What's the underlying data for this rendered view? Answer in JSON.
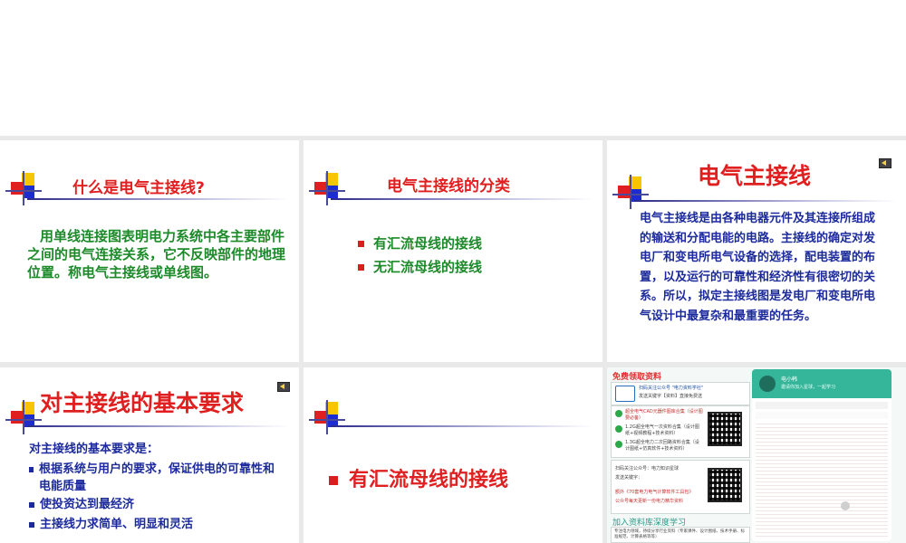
{
  "slides": {
    "s1": {
      "title": "什么是电气主接线?",
      "body": "用单线连接图表明电力系统中各主要部件之间的电气连接关系，它不反映部件的地理位置。称电气主接线或单线图。"
    },
    "s2": {
      "title": "电气主接线的分类",
      "items": [
        "有汇流母线的接线",
        "无汇流母线的接线"
      ]
    },
    "s3": {
      "title": "电气主接线",
      "body": "电气主接线是由各种电器元件及其连接所组成的输送和分配电能的电路。主接线的确定对发电厂和变电所电气设备的选择，配电装置的布置，以及运行的可靠性和经济性有很密切的关系。所以，拟定主接线图是发电厂和变电所电气设计中最复杂和最重要的任务。"
    },
    "s4": {
      "title": "对主接线的基本要求",
      "intro": "对主接线的基本要求是：",
      "items": [
        "根据系统与用户的要求，保证供电的可靠性和电能质量",
        "使投资达到最经济",
        "主接线力求简单、明显和灵活"
      ]
    },
    "s5": {
      "title": "有汇流母线的接线"
    },
    "s6": {
      "header": "免费领取资料",
      "card1": [
        "扫码关注公众号 \"电力资料学社\"",
        "发送关键字【资料】直接免费送"
      ],
      "checks": [
        "超全电气CAD元器件图库合集（设计图要必备）",
        "1.2G超全电气一次资料合集（设计图纸+视频教程+技术资料）",
        "1.3G超全电力二次回路资料合集（设计图纸+仿真软件+技术资料）"
      ],
      "card2": [
        "扫码关注公众号：电力知识星球",
        "发送关键字：",
        "额外《70套电力电气计算软件工具包》",
        "公众号每天更新一份电力精华资料"
      ],
      "header2": "加入资料库深度学习",
      "card3": "专注电力领域，持续分享行业资料（专家课件、设计图纸、技术手册、标准规范、计算表格等等）",
      "panel_title": "电小韩",
      "panel_sub": "邀请你加入星球，一起学习"
    }
  },
  "colors": {
    "title_red": "#e02020",
    "body_green": "#1d8a2a",
    "body_blue": "#1c2a9c"
  },
  "icons": [
    "speaker-icon",
    "deco-squares-icon",
    "bullet-square-icon",
    "qr-code-icon",
    "check-icon"
  ]
}
